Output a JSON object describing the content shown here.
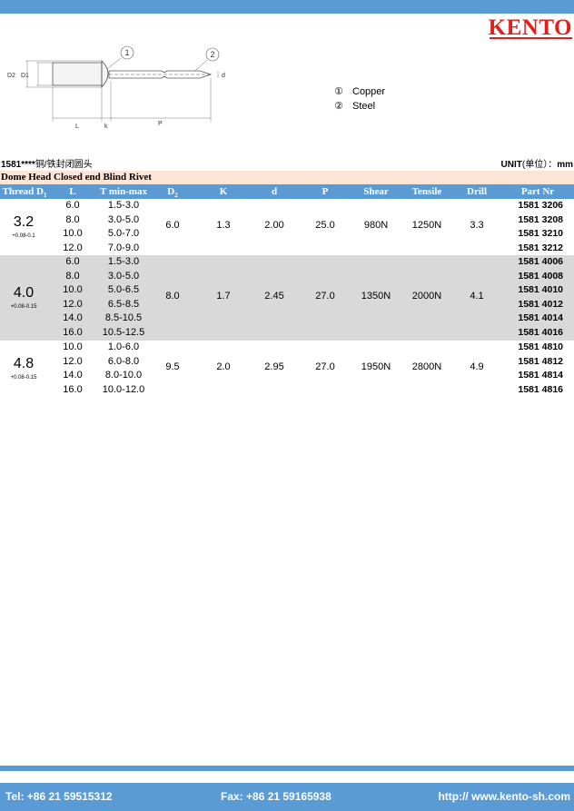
{
  "brand": {
    "logo": "KENTO"
  },
  "diagram": {
    "labels": {
      "d2": "D2",
      "d1": "D1",
      "d": "d",
      "l": "L",
      "k": "k",
      "p": "P",
      "callout1": "1",
      "callout2": "2"
    }
  },
  "legend": [
    {
      "num": "①",
      "label": "Copper"
    },
    {
      "num": "②",
      "label": "Steel"
    }
  ],
  "title": {
    "code": "1581****",
    "name_cn": "铜/铁封闭圆头",
    "unit_label": "UNIT",
    "unit_cn": "(单位）：",
    "unit": "mm"
  },
  "subtitle": "Dome Head Closed end Blind Rivet",
  "columns": [
    "Thread D1",
    "L",
    "T min-max",
    "D2",
    "K",
    "d",
    "P",
    "Shear",
    "Tensile",
    "Drill",
    "Part Nr"
  ],
  "colors": {
    "bar": "#5b9bd5",
    "subtitle_bg": "#fce4d6",
    "shade": "#d9d9d9",
    "logo": "#e0201b"
  },
  "groups": [
    {
      "thread": "3.2",
      "tolerance": "+0.08-0.1",
      "d2": "6.0",
      "k": "1.3",
      "d": "2.00",
      "p": "25.0",
      "shear": "980N",
      "tensile": "1250N",
      "drill": "3.3",
      "rows": [
        {
          "l": "6.0",
          "t": "1.5-3.0",
          "part": "1581 3206"
        },
        {
          "l": "8.0",
          "t": "3.0-5.0",
          "part": "1581 3208"
        },
        {
          "l": "10.0",
          "t": "5.0-7.0",
          "part": "1581 3210"
        },
        {
          "l": "12.0",
          "t": "7.0-9.0",
          "part": "1581 3212"
        }
      ]
    },
    {
      "thread": "4.0",
      "tolerance": "+0.08-0.15",
      "d2": "8.0",
      "k": "1.7",
      "d": "2.45",
      "p": "27.0",
      "shear": "1350N",
      "tensile": "2000N",
      "drill": "4.1",
      "rows": [
        {
          "l": "6.0",
          "t": "1.5-3.0",
          "part": "1581 4006"
        },
        {
          "l": "8.0",
          "t": "3.0-5.0",
          "part": "1581 4008"
        },
        {
          "l": "10.0",
          "t": "5.0-6.5",
          "part": "1581 4010"
        },
        {
          "l": "12.0",
          "t": "6.5-8.5",
          "part": "1581 4012"
        },
        {
          "l": "14.0",
          "t": "8.5-10.5",
          "part": "1581 4014"
        },
        {
          "l": "16.0",
          "t": "10.5-12.5",
          "part": "1581 4016"
        }
      ]
    },
    {
      "thread": "4.8",
      "tolerance": "+0.08-0.15",
      "d2": "9.5",
      "k": "2.0",
      "d": "2.95",
      "p": "27.0",
      "shear": "1950N",
      "tensile": "2800N",
      "drill": "4.9",
      "rows": [
        {
          "l": "10.0",
          "t": "1.0-6.0",
          "part": "1581 4810"
        },
        {
          "l": "12.0",
          "t": "6.0-8.0",
          "part": "1581 4812"
        },
        {
          "l": "14.0",
          "t": "8.0-10.0",
          "part": "1581 4814"
        },
        {
          "l": "16.0",
          "t": "10.0-12.0",
          "part": "1581 4816"
        }
      ]
    }
  ],
  "footer": {
    "tel": "Tel: +86 21 59515312",
    "fax": "Fax: +86 21 59165938",
    "web": "http:// www.kento-sh.com"
  }
}
